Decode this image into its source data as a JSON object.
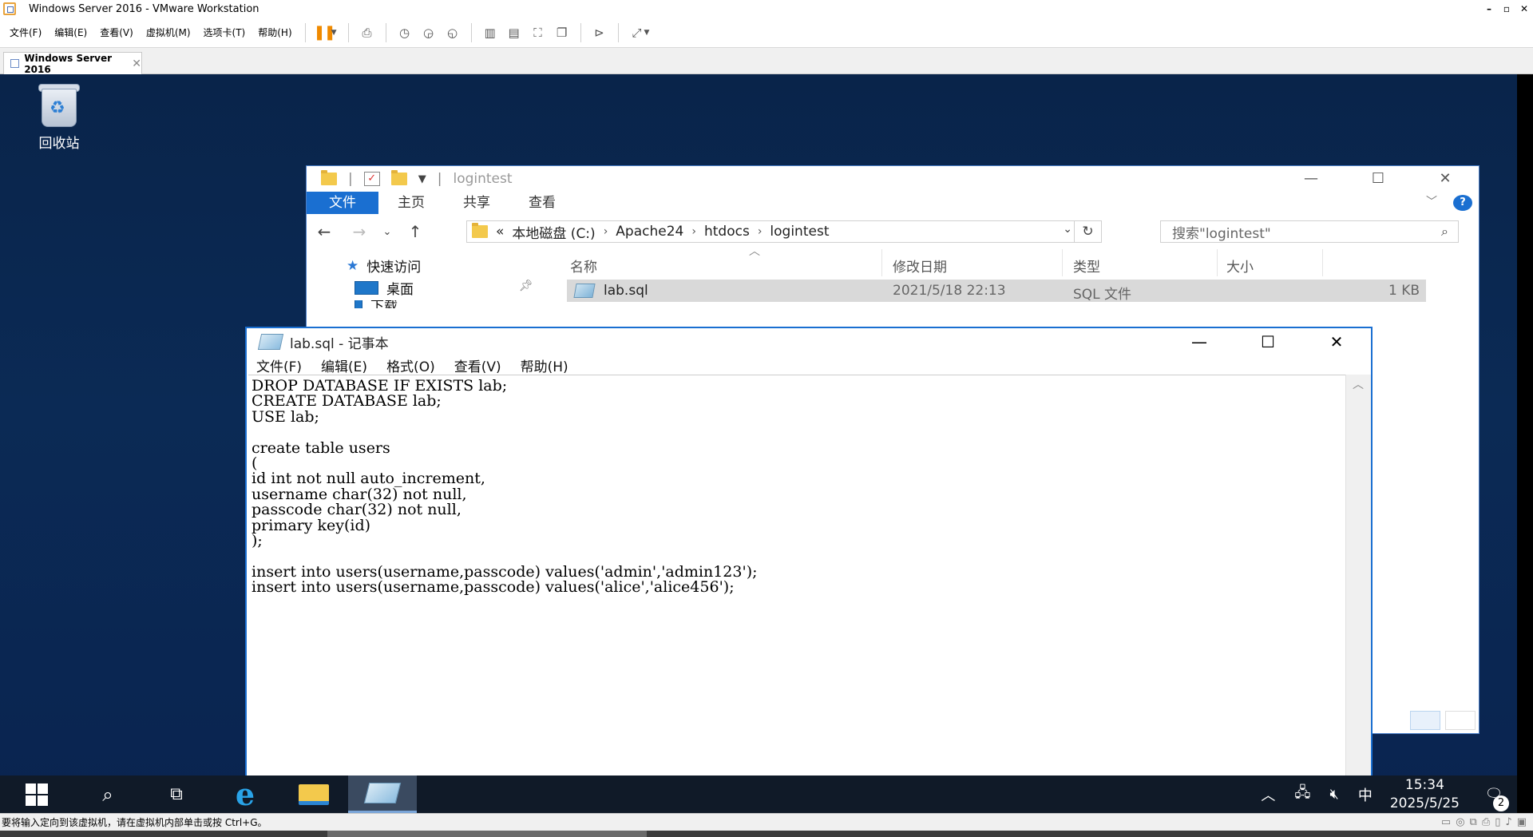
{
  "vm": {
    "window_title": "Windows Server 2016 - VMware Workstation",
    "menu": [
      "文件(F)",
      "编辑(E)",
      "查看(V)",
      "虚拟机(M)",
      "选项卡(T)",
      "帮助(H)"
    ],
    "tab_label": "Windows Server 2016",
    "status_text": "要将输入定向到该虚拟机，请在虚拟机内部单击或按 Ctrl+G。"
  },
  "desktop": {
    "recycle_bin_label": "回收站"
  },
  "explorer": {
    "title": "logintest",
    "ribbon_tabs": [
      "文件",
      "主页",
      "共享",
      "查看"
    ],
    "address": {
      "prefix": "«",
      "crumbs": [
        "本地磁盘 (C:)",
        "Apache24",
        "htdocs",
        "logintest"
      ]
    },
    "search_placeholder": "搜索\"logintest\"",
    "nav": {
      "quick_access": "快速访问",
      "desktop": "桌面",
      "downloads": "下载"
    },
    "columns": [
      "名称",
      "修改日期",
      "类型",
      "大小"
    ],
    "files": [
      {
        "name": "lab.sql",
        "modified": "2021/5/18 22:13",
        "type": "SQL 文件",
        "size": "1 KB"
      }
    ]
  },
  "notepad": {
    "title": "lab.sql - 记事本",
    "menu": [
      "文件(F)",
      "编辑(E)",
      "格式(O)",
      "查看(V)",
      "帮助(H)"
    ],
    "content": "DROP DATABASE IF EXISTS lab;\nCREATE DATABASE lab;\nUSE lab;\n\ncreate table users\n(\nid int not null auto_increment,\nusername char(32) not null,\npasscode char(32) not null,\nprimary key(id)\n);\n\ninsert into users(username,passcode) values('admin','admin123');\ninsert into users(username,passcode) values('alice','alice456');"
  },
  "taskbar": {
    "ime": "中",
    "time": "15:34",
    "date": "2025/5/25",
    "notification_count": "2"
  }
}
